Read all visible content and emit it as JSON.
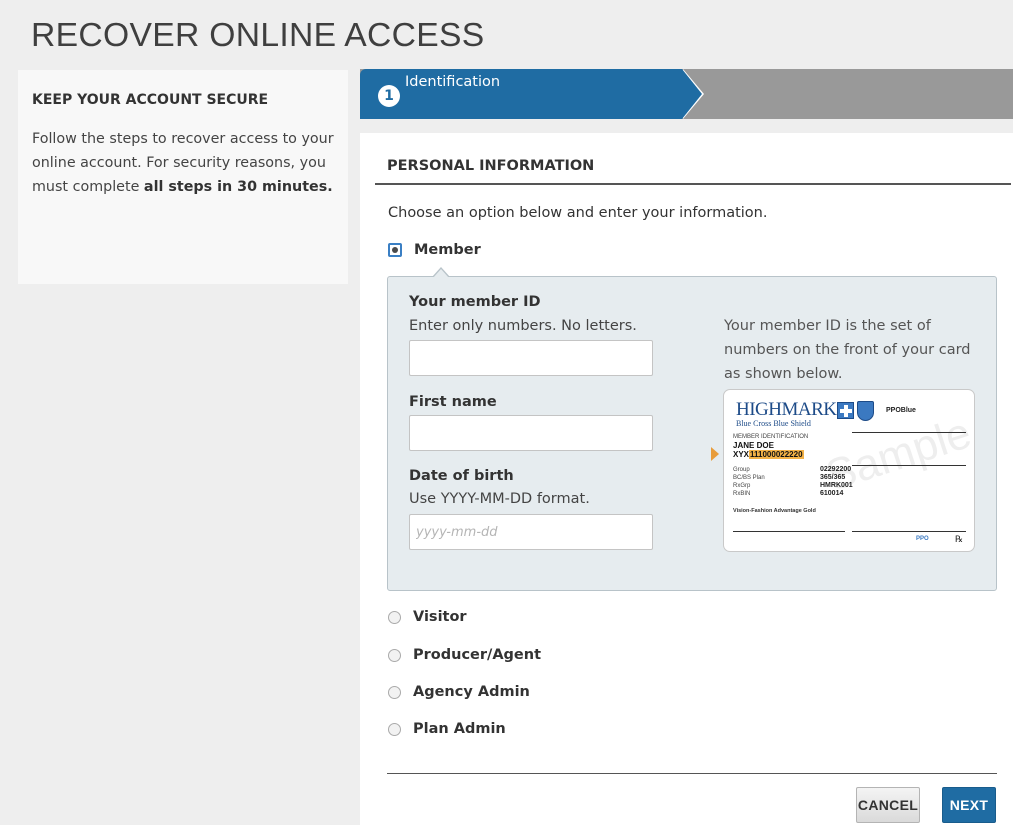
{
  "page": {
    "title": "RECOVER ONLINE ACCESS"
  },
  "sidebar": {
    "heading": "KEEP YOUR ACCOUNT SECURE",
    "text_before": "Follow the steps to recover access to your online account. For security reasons, you must complete ",
    "text_bold": "all steps in 30 minutes."
  },
  "stepper": {
    "active_step_number": "1",
    "active_step_label": "Identification"
  },
  "form": {
    "section_title": "PERSONAL INFORMATION",
    "instructions": "Choose an option below and enter your information.",
    "options": [
      {
        "label": "Member",
        "checked": true
      },
      {
        "label": "Visitor",
        "checked": false
      },
      {
        "label": "Producer/Agent",
        "checked": false
      },
      {
        "label": "Agency Admin",
        "checked": false
      },
      {
        "label": "Plan Admin",
        "checked": false
      }
    ],
    "member_id": {
      "label": "Your member ID",
      "help": "Enter only numbers. No letters.",
      "value": "",
      "placeholder": ""
    },
    "first_name": {
      "label": "First name",
      "value": "",
      "placeholder": ""
    },
    "dob": {
      "label": "Date of birth",
      "help": "Use YYYY-MM-DD format.",
      "value": "",
      "placeholder": "yyyy-mm-dd"
    },
    "card_help": "Your member ID is the set of numbers on the front of your card as shown below.",
    "buttons": {
      "cancel": "CANCEL",
      "next": "NEXT"
    }
  },
  "sample_card": {
    "brand": "HIGHMARK.",
    "brand_sub": "Blue Cross Blue Shield",
    "plan": "PPOBlue",
    "member_id_label": "MEMBER IDENTIFICATION",
    "member_name": "JANE DOE",
    "id_prefix": "XYX",
    "id_number": "111000022220",
    "rows": [
      {
        "label": "Group",
        "value": "02292200"
      },
      {
        "label": "BC/BS Plan",
        "value": "365/365"
      },
      {
        "label": "RxGrp",
        "value": "HMRK001"
      },
      {
        "label": "RxBIN",
        "value": "610014"
      }
    ],
    "product": "Vision-Fashion Advantage Gold",
    "watermark": "Sample",
    "ppo": "PPO",
    "rx": "℞"
  },
  "colors": {
    "accent": "#1f6ca3",
    "step_inactive": "#999999",
    "panel_bg": "#e6ecef",
    "id_highlight": "#f3b247"
  }
}
